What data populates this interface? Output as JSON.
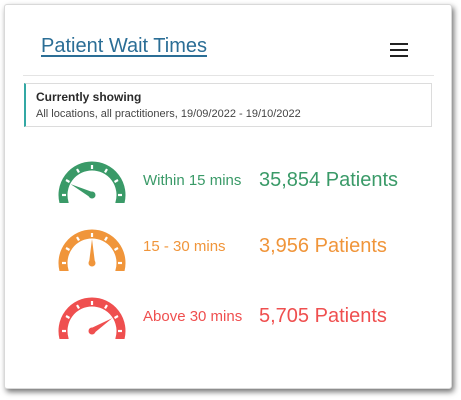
{
  "header": {
    "title": "Patient Wait Times",
    "menu_icon": "hamburger-menu-icon"
  },
  "filter": {
    "heading": "Currently showing",
    "detail": "All locations, all practitioners, 19/09/2022 - 19/10/2022"
  },
  "rows": [
    {
      "label": "Within 15 mins",
      "count": "35,854 Patients",
      "color": "#3a9a68",
      "icon": "speedometer-low-icon",
      "needle_level": 0.15
    },
    {
      "label": "15 - 30 mins",
      "count": "3,956 Patients",
      "color": "#f0953a",
      "icon": "speedometer-mid-icon",
      "needle_level": 0.5
    },
    {
      "label": "Above 30 mins",
      "count": "5,705 Patients",
      "color": "#ef4f4f",
      "icon": "speedometer-high-icon",
      "needle_level": 0.82
    }
  ]
}
